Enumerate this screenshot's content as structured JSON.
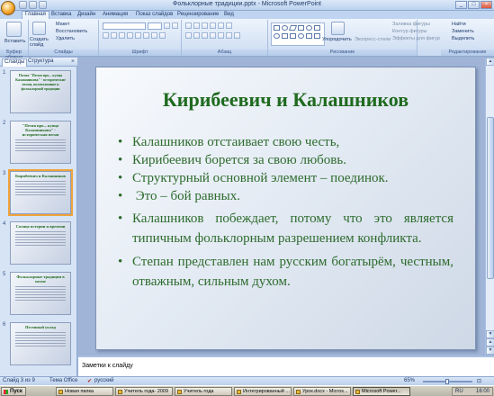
{
  "window": {
    "title": "Фольклорные традиции.pptx - Microsoft PowerPoint",
    "controls": [
      "_",
      "□",
      "×"
    ]
  },
  "ribbon": {
    "tabs": [
      "Главная",
      "Вставка",
      "Дизайн",
      "Анимация",
      "Показ слайдов",
      "Рецензирование",
      "Вид"
    ],
    "clipboard": {
      "paste": "Вставить",
      "group": "Буфер обмена"
    },
    "slides": {
      "new_slide": "Создать слайд",
      "layout": "Макет",
      "reset": "Восстановить",
      "delete": "Удалить",
      "group": "Слайды"
    },
    "font": {
      "group": "Шрифт"
    },
    "paragraph": {
      "group": "Абзац"
    },
    "drawing": {
      "arrange": "Упорядочить",
      "quick_styles": "Экспресс-стили",
      "fill": "Заливка фигуры",
      "outline": "Контур фигуры",
      "effects": "Эффекты для фигур",
      "group": "Рисование"
    },
    "editing": {
      "find": "Найти",
      "replace": "Заменить",
      "select": "Выделить",
      "group": "Редактирование"
    }
  },
  "left_panel": {
    "tabs": [
      "Слайды",
      "Структура"
    ],
    "close": "×",
    "slides": [
      {
        "num": "1",
        "title": "Поэма \"Песня про... купца Калашникова\" - исторические песни, волеизлияние и фольклорной традиции"
      },
      {
        "num": "2",
        "title": "\"Песня про... купца Калашникова\" - историческая песня"
      },
      {
        "num": "3",
        "title": "Кирибеевич и Калашников"
      },
      {
        "num": "4",
        "title": "Солнце истерии и времени"
      },
      {
        "num": "5",
        "title": "Фольклорные традиции в поэме"
      },
      {
        "num": "6",
        "title": "Песенный уклад"
      }
    ]
  },
  "slide": {
    "title": "Кирибеевич и Калашников",
    "bullets": [
      "Калашников отстаивает свою честь,",
      "Кирибеевич борется за свою любовь.",
      "Структурный основной элемент – поединок.",
      " Это – бой равных.",
      "Калашников побеждает, потому что это является типичным фольклорным разрешением конфликта.",
      "Степан представлен нам русским богатырём, честным, отважным, сильным духом."
    ]
  },
  "notes": {
    "placeholder": "Заметки к слайду"
  },
  "status": {
    "slide": "Слайд 3 из 9",
    "theme": "Тема Office",
    "lang": "русский",
    "zoom": "65%"
  },
  "taskbar": {
    "start": "Пуск",
    "items": [
      {
        "label": "Новая папка",
        "active": false
      },
      {
        "label": "Учитель года- 2009",
        "active": false
      },
      {
        "label": "Учитель года",
        "active": false
      },
      {
        "label": "Интегрированный ...",
        "active": false
      },
      {
        "label": "Урок.docx - Micros...",
        "active": false
      },
      {
        "label": "Microsoft Power...",
        "active": true
      }
    ],
    "clock": "16:00",
    "lang": "RU"
  }
}
